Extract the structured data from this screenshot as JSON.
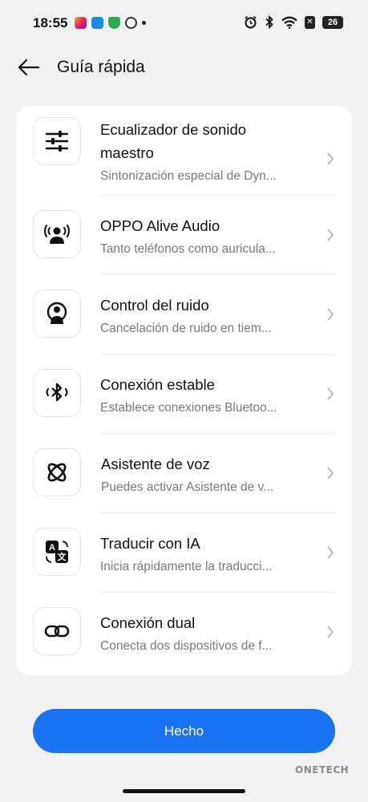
{
  "status_bar": {
    "time": "18:55",
    "battery": "26",
    "notification_icons": [
      "instagram-icon",
      "sync-icon",
      "shield-icon",
      "check-circle-icon",
      "dot-icon"
    ],
    "system_icons": [
      "alarm-icon",
      "bluetooth-icon",
      "wifi-icon",
      "sim-off-icon",
      "battery-icon"
    ]
  },
  "header": {
    "title": "Guía rápida",
    "back_icon": "arrow-left-icon"
  },
  "items": [
    {
      "title": "Ecualizador de sonido",
      "title2": "maestro",
      "desc": "Sintonización especial de Dyn...",
      "icon": "equalizer-icon"
    },
    {
      "title": "OPPO Alive Audio",
      "desc": "Tanto teléfonos como auricula...",
      "icon": "alive-audio-icon"
    },
    {
      "title": "Control del ruido",
      "desc": "Cancelación de ruido en tiem...",
      "icon": "noise-control-icon"
    },
    {
      "title": "Conexión estable",
      "desc": "Establece conexiones Bluetoo...",
      "icon": "bluetooth-stable-icon"
    },
    {
      "title": "Asistente de voz",
      "desc": "Puedes activar Asistente de v...",
      "icon": "voice-assistant-icon"
    },
    {
      "title": "Traducir con IA",
      "desc": "Inicia rápidamente la traducci...",
      "icon": "translate-icon"
    },
    {
      "title": "Conexión dual",
      "desc": "Conecta dos dispositivos de f...",
      "icon": "link-icon"
    }
  ],
  "done_label": "Hecho",
  "watermark": "ONETECH",
  "colors": {
    "accent": "#1a73f0",
    "background": "#f2f2f4",
    "card": "#ffffff"
  }
}
